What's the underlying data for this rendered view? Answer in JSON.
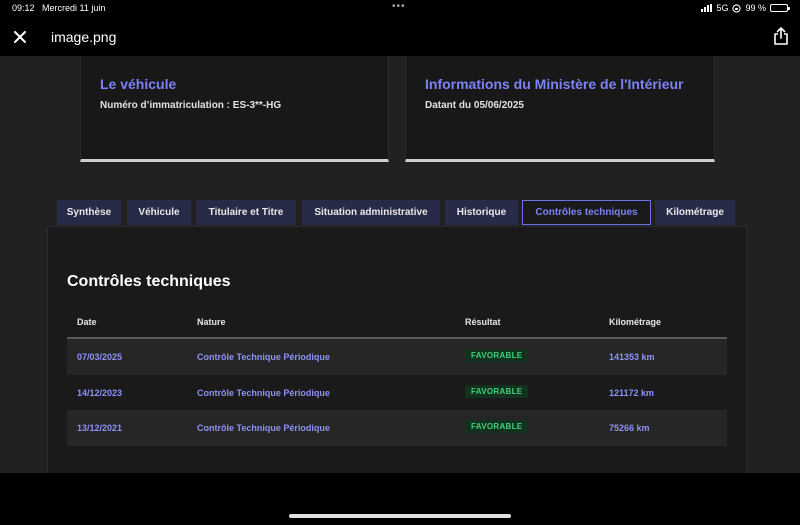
{
  "status": {
    "time": "09:12",
    "date": "Mercredi 11 juin",
    "network": "5G",
    "battery": "99 %",
    "battery_level": 0.99
  },
  "viewer": {
    "filename": "image.png",
    "close_icon": "close-icon",
    "share_icon": "share-icon"
  },
  "cards": [
    {
      "title": "Le véhicule",
      "subtitle": "Numéro d’immatriculation : ES-3**-HG"
    },
    {
      "title": "Informations du Ministère de l'Intérieur",
      "subtitle": "Datant du 05/06/2025"
    }
  ],
  "tabs": [
    {
      "label": "Synthèse",
      "active": false
    },
    {
      "label": "Véhicule",
      "active": false
    },
    {
      "label": "Titulaire et Titre",
      "active": false
    },
    {
      "label": "Situation administrative",
      "active": false
    },
    {
      "label": "Historique",
      "active": false
    },
    {
      "label": "Contrôles techniques",
      "active": true
    },
    {
      "label": "Kilométrage",
      "active": false
    }
  ],
  "section": {
    "title": "Contrôles techniques",
    "columns": [
      "Date",
      "Nature",
      "Résultat",
      "Kilométrage"
    ],
    "rows": [
      {
        "date": "07/03/2025",
        "nature": "Contrôle Technique Périodique",
        "result": "FAVORABLE",
        "km": "141353 km"
      },
      {
        "date": "14/12/2023",
        "nature": "Contrôle Technique Périodique",
        "result": "FAVORABLE",
        "km": "121172 km"
      },
      {
        "date": "13/12/2021",
        "nature": "Contrôle Technique Périodique",
        "result": "FAVORABLE",
        "km": "75266 km"
      }
    ]
  },
  "colors": {
    "accent": "#7b83f7",
    "tab_bg": "#282b47",
    "success": "#3fd07a"
  }
}
